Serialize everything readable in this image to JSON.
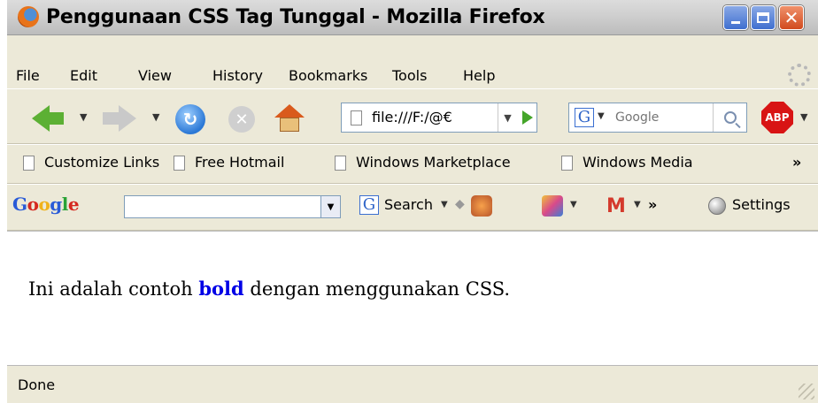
{
  "window": {
    "title": "Penggunaan CSS Tag Tunggal - Mozilla Firefox"
  },
  "menu": {
    "items": [
      "File",
      "Edit",
      "View",
      "History",
      "Bookmarks",
      "Tools",
      "Help"
    ]
  },
  "navigation": {
    "url": "file:///F:/@€",
    "search_placeholder": "Google",
    "adblock_label": "ABP"
  },
  "bookmarks": {
    "items": [
      "Customize Links",
      "Free Hotmail",
      "Windows Marketplace",
      "Windows Media"
    ],
    "overflow": "»"
  },
  "google_toolbar": {
    "search_label": "Search",
    "overflow": "»",
    "settings_label": "Settings"
  },
  "content": {
    "before": "Ini adalah contoh ",
    "bold": "bold",
    "after": " dengan menggunakan CSS."
  },
  "status": {
    "text": "Done"
  }
}
